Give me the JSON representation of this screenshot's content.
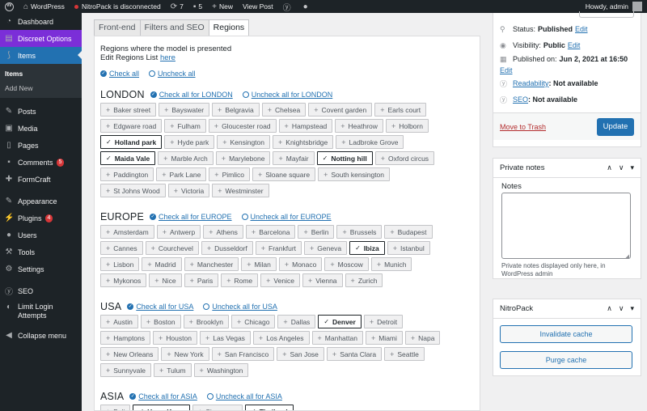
{
  "adminbar": {
    "site": "WordPress",
    "nitro_status": "NitroPack is disconnected",
    "updates": "7",
    "comments": "5",
    "new": "New",
    "view": "View Post",
    "howdy": "Howdy, admin"
  },
  "sidebar": {
    "items": [
      {
        "label": "Dashboard",
        "icon": "dashboard-icon"
      },
      {
        "label": "Discreet Options",
        "icon": "options-icon"
      },
      {
        "label": "Items",
        "icon": "items-icon"
      }
    ],
    "submenu": [
      "Items",
      "Add New"
    ],
    "items2": [
      {
        "label": "Posts",
        "icon": "pin-icon"
      },
      {
        "label": "Media",
        "icon": "media-icon"
      },
      {
        "label": "Pages",
        "icon": "pages-icon"
      },
      {
        "label": "Comments",
        "icon": "comment-icon",
        "badge": "5"
      },
      {
        "label": "FormCraft",
        "icon": "form-icon"
      }
    ],
    "items3": [
      {
        "label": "Appearance",
        "icon": "brush-icon"
      },
      {
        "label": "Plugins",
        "icon": "plug-icon",
        "badge": "4"
      },
      {
        "label": "Users",
        "icon": "user-icon"
      },
      {
        "label": "Tools",
        "icon": "wrench-icon"
      },
      {
        "label": "Settings",
        "icon": "settings-icon"
      }
    ],
    "items4": [
      {
        "label": "SEO",
        "icon": "seo-icon"
      },
      {
        "label": "Limit Login Attempts",
        "icon": "lock-icon"
      },
      {
        "label": "Collapse menu",
        "icon": "collapse-icon"
      }
    ]
  },
  "tabs": [
    "Front-end",
    "Filters and SEO",
    "Regions"
  ],
  "panel": {
    "heading": "Regions where the model is presented",
    "edit_text": "Edit Regions List",
    "edit_link": "here",
    "check_all": "Check all",
    "uncheck_all": "Uncheck all"
  },
  "regions": [
    {
      "name": "LONDON",
      "check": "Check all for LONDON",
      "uncheck": "Uncheck all for LONDON",
      "tags": [
        {
          "t": "Baker street"
        },
        {
          "t": "Bayswater"
        },
        {
          "t": "Belgravia"
        },
        {
          "t": "Chelsea"
        },
        {
          "t": "Covent garden"
        },
        {
          "t": "Earls court"
        },
        {
          "t": "Edgware road"
        },
        {
          "t": "Fulham"
        },
        {
          "t": "Gloucester road"
        },
        {
          "t": "Hampstead"
        },
        {
          "t": "Heathrow"
        },
        {
          "t": "Holborn"
        },
        {
          "t": "Holland park",
          "s": true
        },
        {
          "t": "Hyde park"
        },
        {
          "t": "Kensington"
        },
        {
          "t": "Knightsbridge"
        },
        {
          "t": "Ladbroke Grove"
        },
        {
          "t": "Maida Vale",
          "s": true
        },
        {
          "t": "Marble Arch"
        },
        {
          "t": "Marylebone"
        },
        {
          "t": "Mayfair"
        },
        {
          "t": "Notting hill",
          "s": true
        },
        {
          "t": "Oxford circus"
        },
        {
          "t": "Paddington"
        },
        {
          "t": "Park Lane"
        },
        {
          "t": "Pimlico"
        },
        {
          "t": "Sloane square"
        },
        {
          "t": "South kensington"
        },
        {
          "t": "St Johns Wood"
        },
        {
          "t": "Victoria"
        },
        {
          "t": "Westminster"
        }
      ]
    },
    {
      "name": "EUROPE",
      "check": "Check all for EUROPE",
      "uncheck": "Uncheck all for EUROPE",
      "tags": [
        {
          "t": "Amsterdam"
        },
        {
          "t": "Antwerp"
        },
        {
          "t": "Athens"
        },
        {
          "t": "Barcelona"
        },
        {
          "t": "Berlin"
        },
        {
          "t": "Brussels"
        },
        {
          "t": "Budapest"
        },
        {
          "t": "Cannes"
        },
        {
          "t": "Courchevel"
        },
        {
          "t": "Dusseldorf"
        },
        {
          "t": "Frankfurt"
        },
        {
          "t": "Geneva"
        },
        {
          "t": "Ibiza",
          "s": true
        },
        {
          "t": "Istanbul"
        },
        {
          "t": "Lisbon"
        },
        {
          "t": "Madrid"
        },
        {
          "t": "Manchester"
        },
        {
          "t": "Milan"
        },
        {
          "t": "Monaco"
        },
        {
          "t": "Moscow"
        },
        {
          "t": "Munich"
        },
        {
          "t": "Mykonos"
        },
        {
          "t": "Nice"
        },
        {
          "t": "Paris"
        },
        {
          "t": "Rome"
        },
        {
          "t": "Venice"
        },
        {
          "t": "Vienna"
        },
        {
          "t": "Zurich"
        }
      ]
    },
    {
      "name": "USA",
      "check": "Check all for USA",
      "uncheck": "Uncheck all for USA",
      "tags": [
        {
          "t": "Austin"
        },
        {
          "t": "Boston"
        },
        {
          "t": "Brooklyn"
        },
        {
          "t": "Chicago"
        },
        {
          "t": "Dallas"
        },
        {
          "t": "Denver",
          "s": true
        },
        {
          "t": "Detroit"
        },
        {
          "t": "Hamptons"
        },
        {
          "t": "Houston"
        },
        {
          "t": "Las Vegas"
        },
        {
          "t": "Los Angeles"
        },
        {
          "t": "Manhattan"
        },
        {
          "t": "Miami"
        },
        {
          "t": "Napa"
        },
        {
          "t": "New Orleans"
        },
        {
          "t": "New York"
        },
        {
          "t": "San Francisco"
        },
        {
          "t": "San Jose"
        },
        {
          "t": "Santa Clara"
        },
        {
          "t": "Seattle"
        },
        {
          "t": "Sunnyvale"
        },
        {
          "t": "Tulum"
        },
        {
          "t": "Washington"
        }
      ]
    },
    {
      "name": "ASIA",
      "check": "Check all for ASIA",
      "uncheck": "Uncheck all for ASIA",
      "tags": [
        {
          "t": "Bali"
        },
        {
          "t": "Hong Kong",
          "s": true
        },
        {
          "t": "Singapore"
        },
        {
          "t": "Thailand",
          "s": true
        }
      ]
    }
  ],
  "publish": {
    "status_label": "Status:",
    "status_value": "Published",
    "edit": "Edit",
    "visibility_label": "Visibility:",
    "visibility_value": "Public",
    "published_label": "Published on:",
    "published_value": "Jun 2, 2021 at 16:50",
    "readability_link": "Readability",
    "readability_value": ": Not available",
    "seo_link": "SEO",
    "seo_value": ": Not available",
    "trash": "Move to Trash",
    "update": "Update"
  },
  "private_notes": {
    "title": "Private notes",
    "label": "Notes",
    "help": "Private notes displayed only here, in WordPress admin"
  },
  "nitropack": {
    "title": "NitroPack",
    "invalidate": "Invalidate cache",
    "purge": "Purge cache"
  }
}
